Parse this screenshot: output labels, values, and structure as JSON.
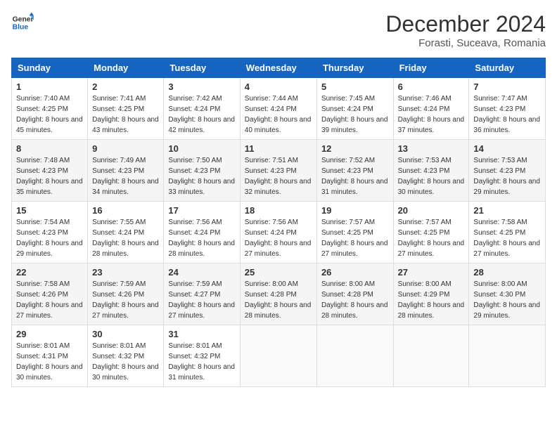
{
  "header": {
    "logo_line1": "General",
    "logo_line2": "Blue",
    "month": "December 2024",
    "location": "Forasti, Suceava, Romania"
  },
  "weekdays": [
    "Sunday",
    "Monday",
    "Tuesday",
    "Wednesday",
    "Thursday",
    "Friday",
    "Saturday"
  ],
  "weeks": [
    [
      {
        "day": "1",
        "sunrise": "Sunrise: 7:40 AM",
        "sunset": "Sunset: 4:25 PM",
        "daylight": "Daylight: 8 hours and 45 minutes."
      },
      {
        "day": "2",
        "sunrise": "Sunrise: 7:41 AM",
        "sunset": "Sunset: 4:25 PM",
        "daylight": "Daylight: 8 hours and 43 minutes."
      },
      {
        "day": "3",
        "sunrise": "Sunrise: 7:42 AM",
        "sunset": "Sunset: 4:24 PM",
        "daylight": "Daylight: 8 hours and 42 minutes."
      },
      {
        "day": "4",
        "sunrise": "Sunrise: 7:44 AM",
        "sunset": "Sunset: 4:24 PM",
        "daylight": "Daylight: 8 hours and 40 minutes."
      },
      {
        "day": "5",
        "sunrise": "Sunrise: 7:45 AM",
        "sunset": "Sunset: 4:24 PM",
        "daylight": "Daylight: 8 hours and 39 minutes."
      },
      {
        "day": "6",
        "sunrise": "Sunrise: 7:46 AM",
        "sunset": "Sunset: 4:24 PM",
        "daylight": "Daylight: 8 hours and 37 minutes."
      },
      {
        "day": "7",
        "sunrise": "Sunrise: 7:47 AM",
        "sunset": "Sunset: 4:23 PM",
        "daylight": "Daylight: 8 hours and 36 minutes."
      }
    ],
    [
      {
        "day": "8",
        "sunrise": "Sunrise: 7:48 AM",
        "sunset": "Sunset: 4:23 PM",
        "daylight": "Daylight: 8 hours and 35 minutes."
      },
      {
        "day": "9",
        "sunrise": "Sunrise: 7:49 AM",
        "sunset": "Sunset: 4:23 PM",
        "daylight": "Daylight: 8 hours and 34 minutes."
      },
      {
        "day": "10",
        "sunrise": "Sunrise: 7:50 AM",
        "sunset": "Sunset: 4:23 PM",
        "daylight": "Daylight: 8 hours and 33 minutes."
      },
      {
        "day": "11",
        "sunrise": "Sunrise: 7:51 AM",
        "sunset": "Sunset: 4:23 PM",
        "daylight": "Daylight: 8 hours and 32 minutes."
      },
      {
        "day": "12",
        "sunrise": "Sunrise: 7:52 AM",
        "sunset": "Sunset: 4:23 PM",
        "daylight": "Daylight: 8 hours and 31 minutes."
      },
      {
        "day": "13",
        "sunrise": "Sunrise: 7:53 AM",
        "sunset": "Sunset: 4:23 PM",
        "daylight": "Daylight: 8 hours and 30 minutes."
      },
      {
        "day": "14",
        "sunrise": "Sunrise: 7:53 AM",
        "sunset": "Sunset: 4:23 PM",
        "daylight": "Daylight: 8 hours and 29 minutes."
      }
    ],
    [
      {
        "day": "15",
        "sunrise": "Sunrise: 7:54 AM",
        "sunset": "Sunset: 4:23 PM",
        "daylight": "Daylight: 8 hours and 29 minutes."
      },
      {
        "day": "16",
        "sunrise": "Sunrise: 7:55 AM",
        "sunset": "Sunset: 4:24 PM",
        "daylight": "Daylight: 8 hours and 28 minutes."
      },
      {
        "day": "17",
        "sunrise": "Sunrise: 7:56 AM",
        "sunset": "Sunset: 4:24 PM",
        "daylight": "Daylight: 8 hours and 28 minutes."
      },
      {
        "day": "18",
        "sunrise": "Sunrise: 7:56 AM",
        "sunset": "Sunset: 4:24 PM",
        "daylight": "Daylight: 8 hours and 27 minutes."
      },
      {
        "day": "19",
        "sunrise": "Sunrise: 7:57 AM",
        "sunset": "Sunset: 4:25 PM",
        "daylight": "Daylight: 8 hours and 27 minutes."
      },
      {
        "day": "20",
        "sunrise": "Sunrise: 7:57 AM",
        "sunset": "Sunset: 4:25 PM",
        "daylight": "Daylight: 8 hours and 27 minutes."
      },
      {
        "day": "21",
        "sunrise": "Sunrise: 7:58 AM",
        "sunset": "Sunset: 4:25 PM",
        "daylight": "Daylight: 8 hours and 27 minutes."
      }
    ],
    [
      {
        "day": "22",
        "sunrise": "Sunrise: 7:58 AM",
        "sunset": "Sunset: 4:26 PM",
        "daylight": "Daylight: 8 hours and 27 minutes."
      },
      {
        "day": "23",
        "sunrise": "Sunrise: 7:59 AM",
        "sunset": "Sunset: 4:26 PM",
        "daylight": "Daylight: 8 hours and 27 minutes."
      },
      {
        "day": "24",
        "sunrise": "Sunrise: 7:59 AM",
        "sunset": "Sunset: 4:27 PM",
        "daylight": "Daylight: 8 hours and 27 minutes."
      },
      {
        "day": "25",
        "sunrise": "Sunrise: 8:00 AM",
        "sunset": "Sunset: 4:28 PM",
        "daylight": "Daylight: 8 hours and 28 minutes."
      },
      {
        "day": "26",
        "sunrise": "Sunrise: 8:00 AM",
        "sunset": "Sunset: 4:28 PM",
        "daylight": "Daylight: 8 hours and 28 minutes."
      },
      {
        "day": "27",
        "sunrise": "Sunrise: 8:00 AM",
        "sunset": "Sunset: 4:29 PM",
        "daylight": "Daylight: 8 hours and 28 minutes."
      },
      {
        "day": "28",
        "sunrise": "Sunrise: 8:00 AM",
        "sunset": "Sunset: 4:30 PM",
        "daylight": "Daylight: 8 hours and 29 minutes."
      }
    ],
    [
      {
        "day": "29",
        "sunrise": "Sunrise: 8:01 AM",
        "sunset": "Sunset: 4:31 PM",
        "daylight": "Daylight: 8 hours and 30 minutes."
      },
      {
        "day": "30",
        "sunrise": "Sunrise: 8:01 AM",
        "sunset": "Sunset: 4:32 PM",
        "daylight": "Daylight: 8 hours and 30 minutes."
      },
      {
        "day": "31",
        "sunrise": "Sunrise: 8:01 AM",
        "sunset": "Sunset: 4:32 PM",
        "daylight": "Daylight: 8 hours and 31 minutes."
      },
      null,
      null,
      null,
      null
    ]
  ]
}
